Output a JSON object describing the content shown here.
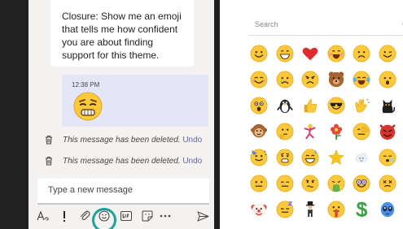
{
  "chat": {
    "closure_message": "Closure: Show me an emoji that tells me how confident you are about finding support for this theme.",
    "sent_time": "12:38 PM",
    "sent_emoji": "worried-face",
    "deleted": [
      {
        "text": "This message has been deleted.",
        "action": "Undo"
      },
      {
        "text": "This message has been deleted.",
        "action": "Undo"
      }
    ],
    "compose_placeholder": "Type a new message",
    "toolbar": [
      "format-icon",
      "important-icon",
      "attach-icon",
      "emoji-icon",
      "gif-icon",
      "sticker-icon",
      "more-icon",
      "send-icon"
    ],
    "highlighted_tool": "emoji-icon",
    "highlight_color": "#1aa39c"
  },
  "picker": {
    "search_placeholder": "Search",
    "rows": [
      [
        "smile",
        "grin",
        "heart",
        "laugh",
        "sad",
        "wink"
      ],
      [
        "blush",
        "cry",
        "angry",
        "teddy-bear",
        "tears-of-joy",
        "surprised"
      ],
      [
        "shocked",
        "penguin",
        "thumbs-up",
        "sunglasses",
        "clapping",
        "cat"
      ],
      [
        "monkey",
        "thinking",
        "dancing",
        "flower",
        "facepalm",
        "devil"
      ],
      [
        "party",
        "worried",
        "sweat",
        "star",
        "cloud",
        "sleepy"
      ],
      [
        "neutral",
        "meh",
        "puzzled",
        "vomit",
        "nerd",
        "dizzy"
      ],
      [
        "clown",
        "sleep",
        "gentleman",
        "shush",
        "money",
        "alien"
      ]
    ]
  },
  "colors": {
    "accent": "#6264a7",
    "chat_background": "#f3f2f1",
    "frame": "#212121",
    "sent_bubble": "#e4e5f8",
    "emoji_yellow": "#fcc93a"
  }
}
